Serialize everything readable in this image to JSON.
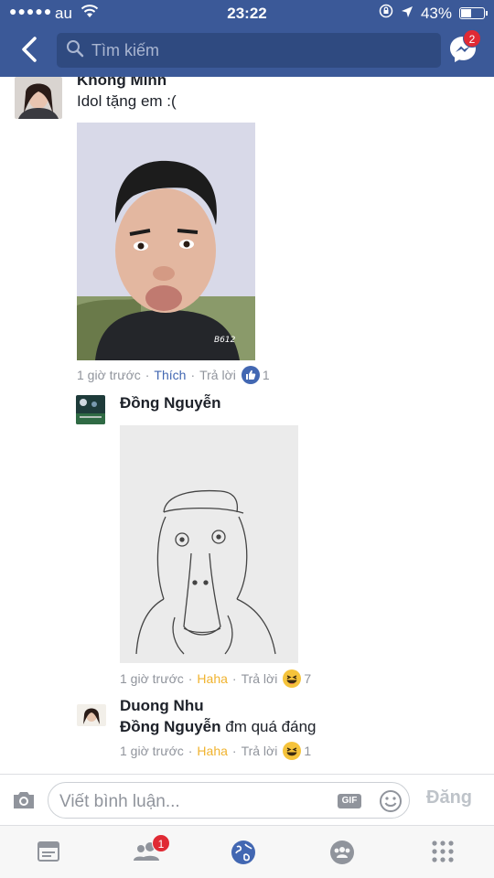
{
  "status_bar": {
    "carrier": "au",
    "time": "23:22",
    "battery": "43%"
  },
  "nav": {
    "search_placeholder": "Tìm kiếm",
    "messenger_badge": "2"
  },
  "comments": [
    {
      "name": "Khổng Minh",
      "text": "Idol tặng em :(",
      "time": "1 giờ trước",
      "action": "Thích",
      "reply": "Trả lời",
      "reaction": "like-icon",
      "reaction_count": "1"
    },
    {
      "name": "Đồng Nguyễn",
      "text": "",
      "time": "1 giờ trước",
      "action": "Haha",
      "reply": "Trả lời",
      "reaction": "haha-icon",
      "reaction_count": "7"
    },
    {
      "name": "Duong Nhu",
      "mention": "Đồng Nguyễn",
      "text": "đm quá đáng",
      "time": "1 giờ trước",
      "action": "Haha",
      "reply": "Trả lời",
      "reaction": "haha-icon",
      "reaction_count": "1"
    }
  ],
  "composer": {
    "placeholder": "Viết bình luận...",
    "gif_label": "GIF",
    "post_label": "Đăng"
  },
  "tabbar": {
    "friends_badge": "1"
  },
  "colors": {
    "brand": "#3b5998",
    "haha": "#f0b32f",
    "like": "#4267b2",
    "badge": "#e02a34"
  }
}
